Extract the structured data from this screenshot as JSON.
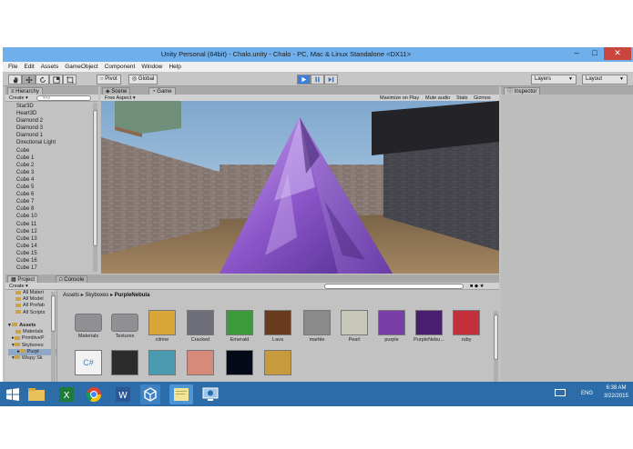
{
  "window": {
    "title": "Unity Personal (64bit) - Chalo.unity - Chalo - PC, Mac & Linux Standalone <DX11>",
    "minimize": "–",
    "maximize": "□",
    "close": "✕"
  },
  "menu": [
    "File",
    "Edit",
    "Assets",
    "GameObject",
    "Component",
    "Window",
    "Help"
  ],
  "toolbar": {
    "tools": [
      "hand-icon",
      "move-icon",
      "rotate-icon",
      "scale-icon",
      "rect-icon"
    ],
    "pivot": "Pivot",
    "global": "Global",
    "layers": "Layers",
    "layout": "Layout"
  },
  "hierarchy": {
    "tab": "Hierarchy",
    "create": "Create",
    "search_placeholder": "▾All",
    "items": [
      "Star3D",
      "Heart3D",
      "Diamond 2",
      "Diamond 3",
      "Diamond 1",
      "Directional Light",
      "Cube",
      "Cube 1",
      "Cube 2",
      "Cube 3",
      "Cube 4",
      "Cube 5",
      "Cube 6",
      "Cube 7",
      "Cube 8",
      "Cube 10",
      "Cube 11",
      "Cube 12",
      "Cube 13",
      "Cube 14",
      "Cube 15",
      "Cube 16",
      "Cube 17"
    ]
  },
  "scene": {
    "tab_scene": "Scene",
    "tab_game": "Game",
    "aspect": "Free Aspect",
    "maximize_on_play": "Maximize on Play",
    "mute_audio": "Mute audio",
    "stats": "Stats",
    "gizmos": "Gizmos"
  },
  "inspector": {
    "tab": "Inspector"
  },
  "project": {
    "tab_project": "Project",
    "tab_console": "Console",
    "create": "Create",
    "breadcrumb": [
      "Assets",
      "Skyboxes",
      "PurpleNebula"
    ],
    "tree": [
      {
        "label": "All Materi",
        "indent": 1
      },
      {
        "label": "All Model",
        "indent": 1
      },
      {
        "label": "All Prefab",
        "indent": 1
      },
      {
        "label": "All Scripts",
        "indent": 1
      },
      {
        "label": "",
        "indent": 0
      },
      {
        "label": "Assets",
        "indent": 0
      },
      {
        "label": "Materials",
        "indent": 1
      },
      {
        "label": "PrimitiveP",
        "indent": 1
      },
      {
        "label": "Skyboxes",
        "indent": 1
      },
      {
        "label": "Purpl",
        "indent": 2
      },
      {
        "label": "Wispy Sk",
        "indent": 1
      }
    ],
    "assets": [
      {
        "label": "Materials",
        "kind": "folder"
      },
      {
        "label": "Textures",
        "kind": "folder"
      },
      {
        "label": "citrine",
        "kind": "tex",
        "color": "#d9a63a"
      },
      {
        "label": "Cracked",
        "kind": "tex",
        "color": "#6e6e78"
      },
      {
        "label": "Emerald",
        "kind": "tex",
        "color": "#3c9a3a"
      },
      {
        "label": "Lava",
        "kind": "tex",
        "color": "#6a3a1f"
      },
      {
        "label": "marble",
        "kind": "tex",
        "color": "#8a8a8a"
      },
      {
        "label": "Pearl",
        "kind": "tex",
        "color": "#c8c8b8"
      },
      {
        "label": "purple",
        "kind": "tex",
        "color": "#7a3ea8"
      },
      {
        "label": "PurpleNebu...",
        "kind": "tex",
        "color": "#4a1e6e"
      },
      {
        "label": "ruby",
        "kind": "tex",
        "color": "#c2303a"
      },
      {
        "label": "",
        "kind": "script"
      },
      {
        "label": "",
        "kind": "tex",
        "color": "#2c2c2c"
      },
      {
        "label": "",
        "kind": "tex",
        "color": "#4a9ab0"
      },
      {
        "label": "",
        "kind": "tex",
        "color": "#d88a7a"
      },
      {
        "label": "",
        "kind": "tex",
        "color": "#050a18"
      },
      {
        "label": "",
        "kind": "tex",
        "color": "#c89a3e"
      }
    ]
  },
  "taskbar": {
    "icons": [
      "windows-start-icon",
      "file-explorer-icon",
      "excel-icon",
      "chrome-icon",
      "word-icon",
      "unity-icon",
      "sticky-notes-icon",
      "remote-desktop-icon"
    ],
    "lang": "ENG",
    "time": "6:38 AM",
    "date": "3/22/2015"
  }
}
